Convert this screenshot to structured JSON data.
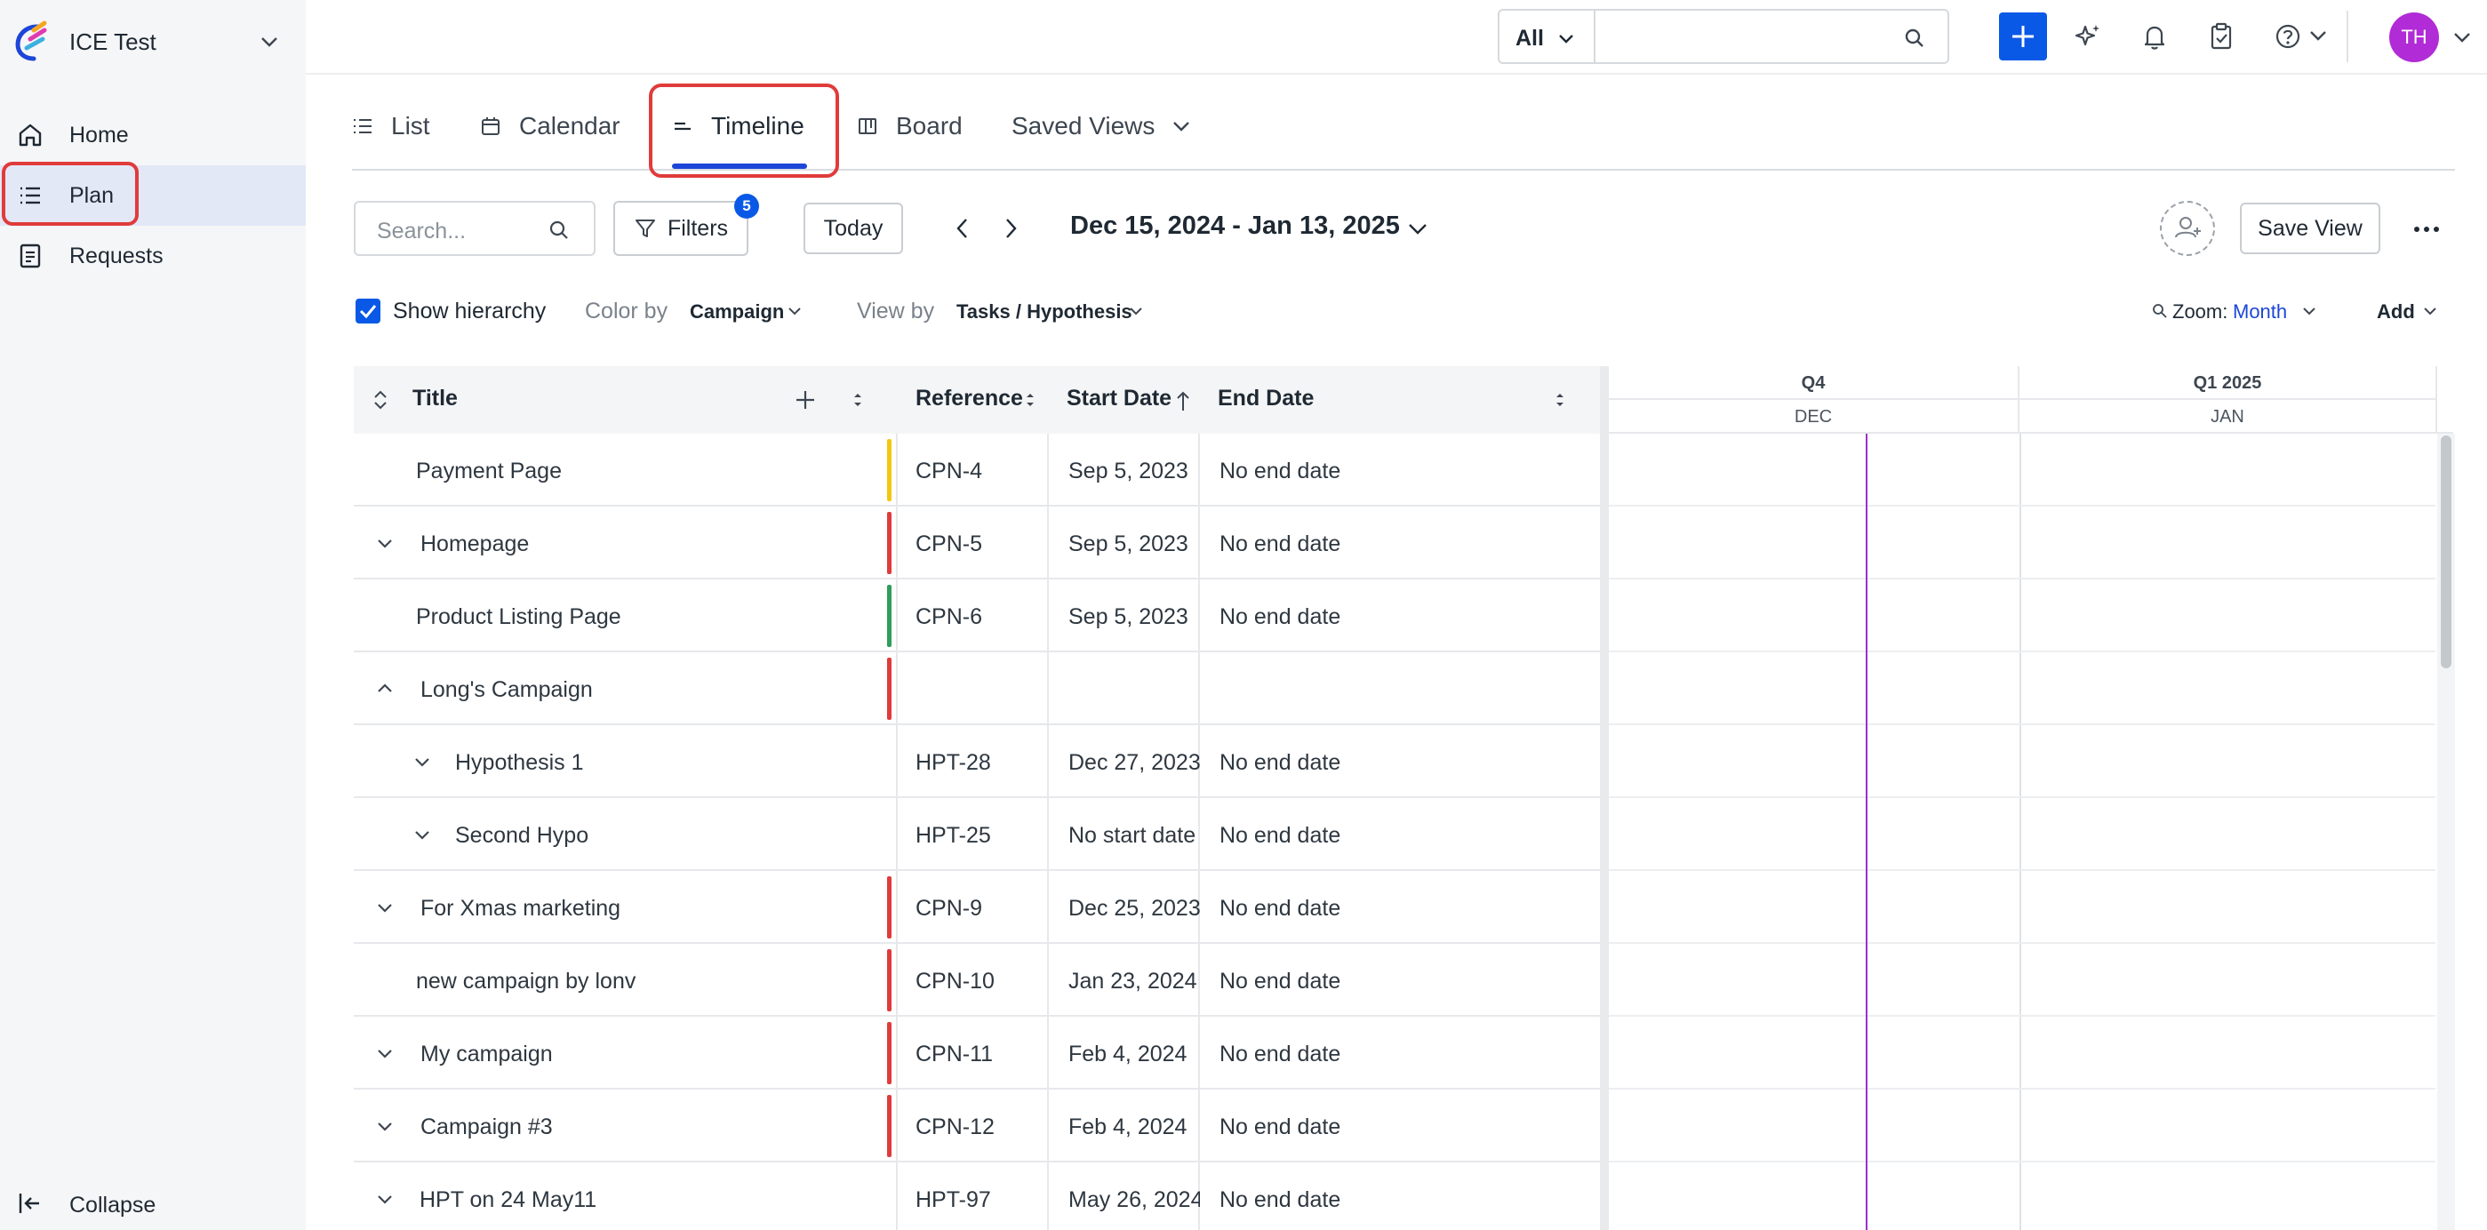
{
  "app": {
    "workspace": "ICE Test"
  },
  "sidebar": {
    "items": [
      {
        "label": "Home",
        "icon": "home-icon"
      },
      {
        "label": "Plan",
        "icon": "list-icon",
        "active": true
      },
      {
        "label": "Requests",
        "icon": "document-icon"
      }
    ],
    "collapse_label": "Collapse"
  },
  "topbar": {
    "scope": "All",
    "search_value": "",
    "avatar_initials": "TH",
    "accent": "#0a59e6",
    "avatar_color": "#b12bd6"
  },
  "tabs": [
    {
      "label": "List",
      "icon": "list-icon"
    },
    {
      "label": "Calendar",
      "icon": "calendar-icon"
    },
    {
      "label": "Timeline",
      "icon": "timeline-icon",
      "active": true
    },
    {
      "label": "Board",
      "icon": "board-icon"
    },
    {
      "label": "Saved Views",
      "icon": "chevron-down-icon"
    }
  ],
  "toolbar": {
    "search_placeholder": "Search...",
    "filters_label": "Filters",
    "filters_count": "5",
    "today_label": "Today",
    "date_range": "Dec 15, 2024 - Jan 13, 2025",
    "save_view_label": "Save View"
  },
  "options": {
    "show_hierarchy_label": "Show hierarchy",
    "show_hierarchy_checked": true,
    "color_by_label": "Color by",
    "color_by_value": "Campaign",
    "view_by_label": "View by",
    "view_by_value": "Tasks / Hypothesis",
    "zoom_label": "Zoom:",
    "zoom_value": "Month",
    "add_label": "Add"
  },
  "grid": {
    "columns": {
      "title": "Title",
      "reference": "Reference",
      "start": "Start Date",
      "end": "End Date"
    },
    "rows": [
      {
        "title": "Payment Page",
        "ref": "CPN-4",
        "start": "Sep 5, 2023",
        "end": "No end date",
        "color": "#f2c80f",
        "chevron": "none",
        "indent": 0
      },
      {
        "title": "Homepage",
        "ref": "CPN-5",
        "start": "Sep 5, 2023",
        "end": "No end date",
        "color": "#e03b3b",
        "chevron": "down",
        "indent": 0
      },
      {
        "title": "Product Listing Page",
        "ref": "CPN-6",
        "start": "Sep 5, 2023",
        "end": "No end date",
        "color": "#2e9e5a",
        "chevron": "none",
        "indent": 0
      },
      {
        "title": "Long's Campaign",
        "ref": "",
        "start": "",
        "end": "",
        "color": "#e03b3b",
        "chevron": "up",
        "indent": 0
      },
      {
        "title": "Hypothesis 1",
        "ref": "HPT-28",
        "start": "Dec 27, 2023",
        "end": "No end date",
        "color": "",
        "chevron": "down",
        "indent": 1
      },
      {
        "title": "Second Hypo",
        "ref": "HPT-25",
        "start": "No start date",
        "end": "No end date",
        "color": "",
        "chevron": "down",
        "indent": 1
      },
      {
        "title": "For Xmas marketing",
        "ref": "CPN-9",
        "start": "Dec 25, 2023",
        "end": "No end date",
        "color": "#e03b3b",
        "chevron": "down",
        "indent": 0
      },
      {
        "title": "new campaign by lonv",
        "ref": "CPN-10",
        "start": "Jan 23, 2024",
        "end": "No end date",
        "color": "#e03b3b",
        "chevron": "none",
        "indent": 0
      },
      {
        "title": "My campaign",
        "ref": "CPN-11",
        "start": "Feb 4, 2024",
        "end": "No end date",
        "color": "#e03b3b",
        "chevron": "down",
        "indent": 0
      },
      {
        "title": "Campaign #3",
        "ref": "CPN-12",
        "start": "Feb 4, 2024",
        "end": "No end date",
        "color": "#e03b3b",
        "chevron": "down",
        "indent": 0
      },
      {
        "title": "HPT on 24 May11",
        "ref": "HPT-97",
        "start": "May 26, 2024",
        "end": "No end date",
        "color": "",
        "chevron": "down",
        "indent": -1
      }
    ]
  },
  "timeline": {
    "quarters": [
      "Q4",
      "Q1 2025"
    ],
    "months": [
      "DEC",
      "JAN"
    ],
    "today_line_color": "#9b2fd0"
  }
}
